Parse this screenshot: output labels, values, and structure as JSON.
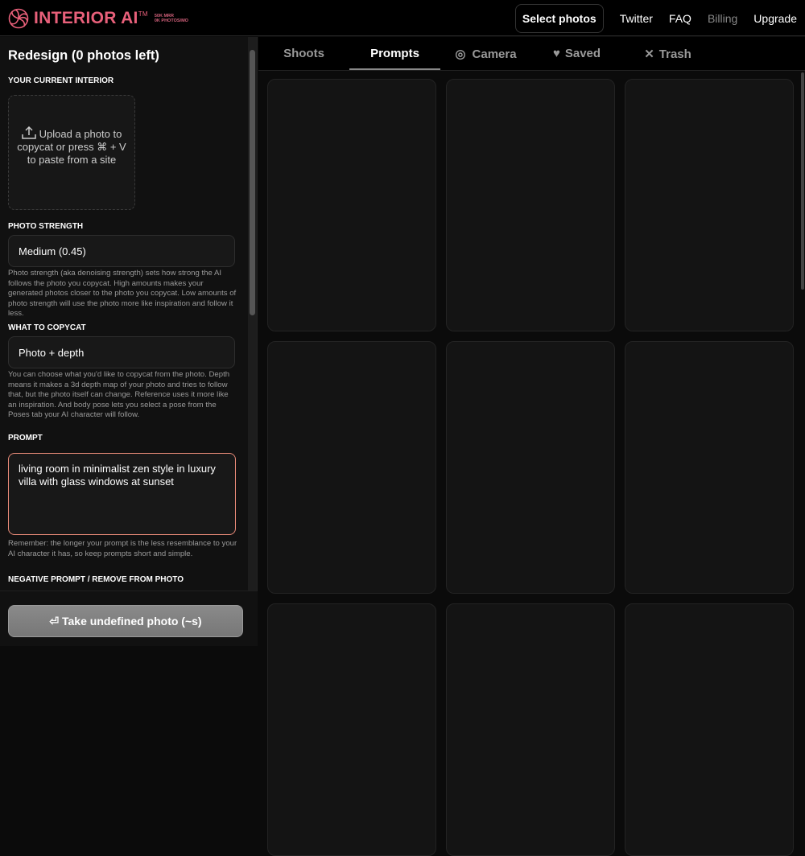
{
  "brand": {
    "name": "INTERIOR AI",
    "tm": "TM",
    "stats": [
      "50K MRR",
      "0K PHOTOS/MO"
    ],
    "color": "#e8607a"
  },
  "nav": {
    "select_photos": "Select photos",
    "links": [
      "Twitter",
      "FAQ",
      "Billing",
      "Upgrade"
    ]
  },
  "sidebar": {
    "title": "Redesign (0 photos left)",
    "current_interior_label": "YOUR CURRENT INTERIOR",
    "upload_text": "Upload a photo to copycat or press ⌘ + V to paste from a site",
    "photo_strength_label": "PHOTO STRENGTH",
    "photo_strength_value": "Medium (0.45)",
    "photo_strength_help": "Photo strength (aka denoising strength) sets how strong the AI follows the photo you copycat. High amounts makes your generated photos closer to the photo you copycat. Low amounts of photo strength will use the photo more like inspiration and follow it less.",
    "copycat_label": "WHAT TO COPYCAT",
    "copycat_value": "Photo + depth",
    "copycat_help": "You can choose what you'd like to copycat from the photo. Depth means it makes a 3d depth map of your photo and tries to follow that, but the photo itself can change. Reference uses it more like an inspiration. And body pose lets you select a pose from the Poses tab your AI character will follow.",
    "prompt_label": "PROMPT",
    "prompt_value": "living room in minimalist zen style in luxury villa with glass windows at sunset",
    "prompt_help": "Remember: the longer your prompt is the less resemblance to your AI character it has, so keep prompts short and simple.",
    "negative_label": "NEGATIVE PROMPT / REMOVE FROM PHOTO",
    "take_button": "⏎ Take undefined photo (~s)"
  },
  "tabs": [
    "Shoots",
    "Prompts",
    "Camera",
    "Saved",
    "Trash"
  ],
  "active_tab": "Prompts"
}
